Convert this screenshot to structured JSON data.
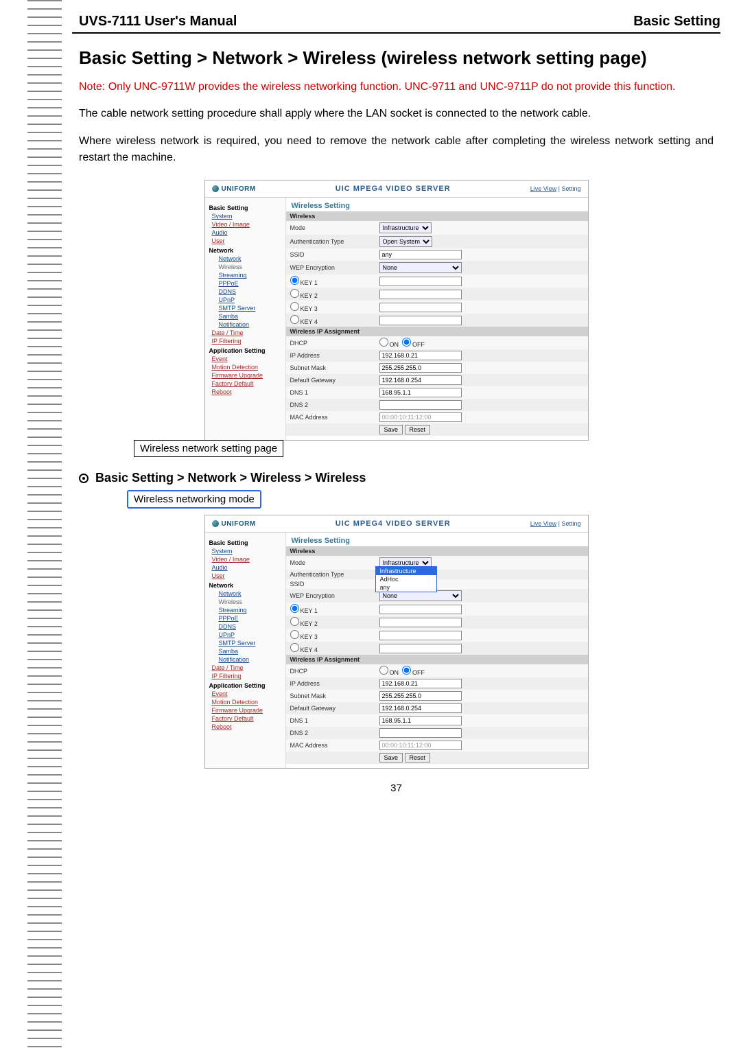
{
  "header": {
    "left": "UVS-7111 User's Manual",
    "right": "Basic Setting"
  },
  "title": "Basic Setting > Network > Wireless (wireless network setting page)",
  "note": "Note: Only UNC-9711W provides the wireless networking function. UNC-9711 and UNC-9711P do not provide this function.",
  "para1": "The cable network setting procedure shall apply where the LAN socket is connected to the network cable.",
  "para2": "Where wireless network is required, you need to remove the network cable after completing the wireless network setting and restart the machine.",
  "caption1": "Wireless network setting page",
  "subheading": "Basic Setting > Network > Wireless > Wireless",
  "caption2": "Wireless networking mode",
  "page_number": "37",
  "ui": {
    "brand": "UNIFORM",
    "server_title": "UIC MPEG4 VIDEO SERVER",
    "toplinks": {
      "live_view": "Live View",
      "setting": "Setting"
    },
    "nav": {
      "basic_setting": "Basic Setting",
      "system": "System",
      "video_image": "Video / Image",
      "audio": "Audio",
      "user": "User",
      "network": "Network",
      "network_sub": "Network",
      "wireless": "Wireless",
      "streaming": "Streaming",
      "pppoe": "PPPoE",
      "ddns": "DDNS",
      "upnp": "UPnP",
      "smtp": "SMTP Server",
      "samba": "Samba",
      "notification": "Notification",
      "date_time": "Date / Time",
      "ip_filtering": "IP Filtering",
      "app_setting": "Application Setting",
      "event": "Event",
      "motion": "Motion Detection",
      "firmware": "Firmware Upgrade",
      "factory": "Factory Default",
      "reboot": "Reboot"
    },
    "panel_title": "Wireless Setting",
    "sections": {
      "wireless": "Wireless",
      "ip": "Wireless IP Assignment"
    },
    "labels": {
      "mode": "Mode",
      "auth": "Authentication Type",
      "ssid": "SSID",
      "wep": "WEP Encryption",
      "key1": "KEY 1",
      "key2": "KEY 2",
      "key3": "KEY 3",
      "key4": "KEY 4",
      "dhcp": "DHCP",
      "ip": "IP Address",
      "mask": "Subnet Mask",
      "gateway": "Default Gateway",
      "dns1": "DNS 1",
      "dns2": "DNS 2",
      "mac": "MAC Address",
      "on": "ON",
      "off": "OFF"
    },
    "values": {
      "mode": "Infrastructure",
      "auth": "Open System",
      "ssid": "any",
      "wep": "None",
      "ip": "192.168.0.21",
      "mask": "255.255.255.0",
      "gateway": "192.168.0.254",
      "dns1": "168.95.1.1",
      "dns2": "",
      "mac": "00:00:10:11:12:00"
    },
    "mode_options": {
      "infra": "Infrastructure",
      "adhoc": "AdHoc",
      "any": "any"
    },
    "buttons": {
      "save": "Save",
      "reset": "Reset"
    }
  }
}
